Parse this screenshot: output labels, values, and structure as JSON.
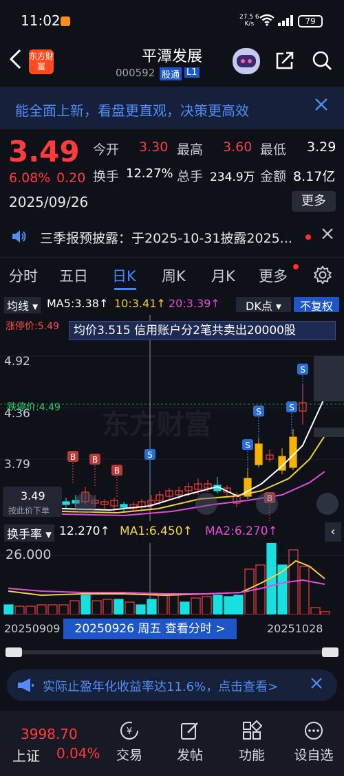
{
  "status_bar": {
    "time": "11:02",
    "net_speed": "27.5",
    "net_unit": "K/s",
    "net_gen": "6",
    "battery": "79"
  },
  "header": {
    "stock_name": "平潭发展",
    "stock_code": "000592",
    "tag_market": "股通",
    "tag_level": "L1",
    "logo_text": "东方财富"
  },
  "banner": {
    "text": "能全面上新，看盘更直观，决策更高效"
  },
  "quote": {
    "price": "3.49",
    "change_pct": "6.08%",
    "change": "0.20",
    "date": "2025/09/26",
    "open_label": "今开",
    "open": "3.30",
    "high_label": "最高",
    "high": "3.60",
    "low_label": "最低",
    "low": "3.29",
    "turnover_label": "换手",
    "turnover": "12.27%",
    "volume_label": "总手",
    "volume": "234.9万",
    "amount_label": "金额",
    "amount": "8.17亿",
    "more_label": "更多"
  },
  "notice": {
    "text": "三季报预披露：于2025-10-31披露2025..."
  },
  "tabs": [
    "分时",
    "五日",
    "日K",
    "周K",
    "月K",
    "更多"
  ],
  "active_tab": "日K",
  "indicators": {
    "ma_selector": "均线",
    "ma5": "MA5:3.38↑",
    "ma10": "10:3.41↑",
    "ma20": "20:3.39↑",
    "dk_label": "DK点",
    "fq_label": "不复权"
  },
  "kchart": {
    "tooltip": "均价3.515  信用账户分2笔共卖出20000股",
    "zt_label": "涨停价:5.49",
    "dt_label": "跌停价:4.49",
    "price_labels": [
      "5.49",
      "4.92",
      "4.36",
      "3.79"
    ],
    "cursor_price": "3.49",
    "cursor_hint": "按此价下单",
    "watermark": "东方财富",
    "colors": {
      "up": "#ff3b3b",
      "down": "#19e0e0",
      "ma5": "#ffffff",
      "ma10": "#f4d03f",
      "ma20": "#e44cd9"
    },
    "b_marker": "B",
    "s_marker": "S"
  },
  "turnover_panel": {
    "selector": "换手率",
    "value": "12.270↑",
    "ma1": "MA1:6.450↑",
    "ma2": "MA2:6.270↑",
    "max_label": "26.000"
  },
  "date_axis": {
    "left": "20250909",
    "mid": "20250926 周五 查看分时 >",
    "right": "20251028"
  },
  "promo": {
    "text": "实际止盈年化收益率达11.6%，点击查看>"
  },
  "bottom_nav": {
    "index_value": "3998.70",
    "index_name": "上证",
    "index_pct": "0.04%",
    "items": [
      "交易",
      "发帖",
      "功能",
      "设自选"
    ]
  }
}
